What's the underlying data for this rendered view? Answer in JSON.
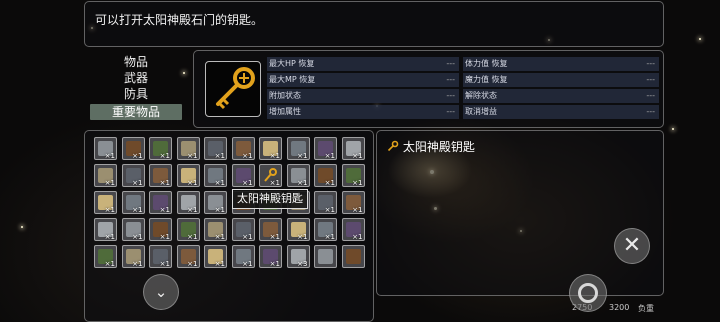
{
  "description": "可以打开太阳神殿石门的钥匙。",
  "categories": [
    {
      "label": "物品",
      "selected": false
    },
    {
      "label": "武器",
      "selected": false
    },
    {
      "label": "防具",
      "selected": false
    },
    {
      "label": "重要物品",
      "selected": true
    }
  ],
  "stats": [
    {
      "left": {
        "label": "最大HP 恢复",
        "value": "---"
      },
      "right": {
        "label": "体力值 恢复",
        "value": "---"
      }
    },
    {
      "left": {
        "label": "最大MP 恢复",
        "value": "---"
      },
      "right": {
        "label": "魔力值 恢复",
        "value": "---"
      }
    },
    {
      "left": {
        "label": "附加状态",
        "value": "---"
      },
      "right": {
        "label": "解除状态",
        "value": "---"
      }
    },
    {
      "left": {
        "label": "增加属性",
        "value": "---"
      },
      "right": {
        "label": "取消增益",
        "value": "---"
      }
    }
  ],
  "selected_item": {
    "name": "太阳神殿钥匙",
    "icon": "golden-key-icon"
  },
  "tooltip": "太阳神殿钥匙",
  "inventory_rows": [
    [
      "×1",
      "×1",
      "×1",
      "×1",
      "×1",
      "×1",
      "×1",
      "×1",
      "×1",
      "×1"
    ],
    [
      "×1",
      "×1",
      "×1",
      "×1",
      "×1",
      "×1",
      "×1",
      "×1",
      "×1",
      "×1"
    ],
    [
      "×1",
      "×1",
      "×1",
      "×1",
      "×1",
      "",
      "",
      "",
      "×1",
      "×1"
    ],
    [
      "×1",
      "×1",
      "×1",
      "×1",
      "×1",
      "×1",
      "×1",
      "×1",
      "×1",
      "×1"
    ],
    [
      "×1",
      "×1",
      "×1",
      "×1",
      "×1",
      "×1",
      "×1",
      "×3",
      "",
      ""
    ]
  ],
  "footer": {
    "value_a": "2750",
    "value_b": "3200",
    "label": "负重"
  },
  "buttons": {
    "close": "✕",
    "down": "⌄"
  },
  "colors": {
    "accent": "#5e6e63",
    "key_gold": "#e2a21c"
  }
}
